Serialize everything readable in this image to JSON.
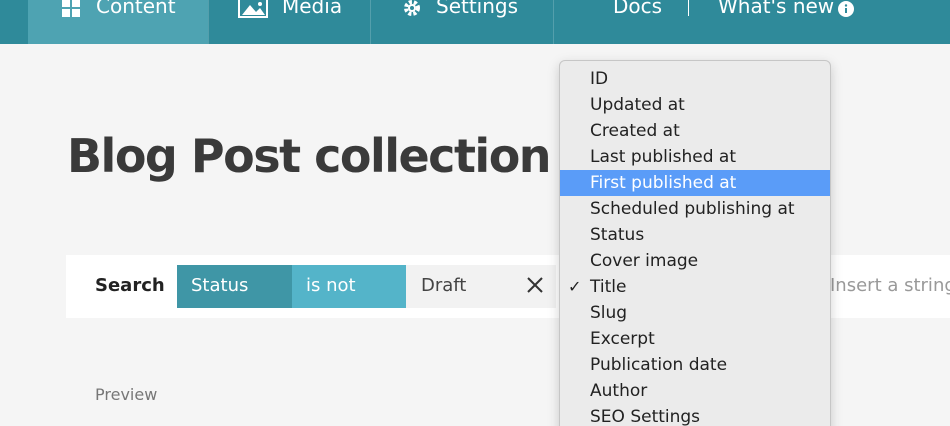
{
  "nav": {
    "items": [
      {
        "label": "Content",
        "icon": "content-icon"
      },
      {
        "label": "Media",
        "icon": "image-icon"
      },
      {
        "label": "Settings",
        "icon": "gear-icon"
      }
    ],
    "docs": "Docs",
    "whats_new": "What's new"
  },
  "page": {
    "title": "Blog Post collection"
  },
  "search": {
    "label": "Search",
    "field": "Status",
    "operator": "is not",
    "value": "Draft",
    "placeholder": "Insert a string..."
  },
  "preview": {
    "label": "Preview"
  },
  "dropdown": {
    "items": [
      {
        "label": "ID"
      },
      {
        "label": "Updated at"
      },
      {
        "label": "Created at"
      },
      {
        "label": "Last published at"
      },
      {
        "label": "First published at",
        "highlighted": true
      },
      {
        "label": "Scheduled publishing at"
      },
      {
        "label": "Status"
      },
      {
        "label": "Cover image"
      },
      {
        "label": "Title",
        "checked": true,
        "check_mark": "✓"
      },
      {
        "label": "Slug"
      },
      {
        "label": "Excerpt"
      },
      {
        "label": "Publication date"
      },
      {
        "label": "Author"
      },
      {
        "label": "SEO Settings"
      }
    ]
  },
  "colors": {
    "nav_bg": "#2f8a9a",
    "nav_active": "#4ea3b2",
    "chip_field": "#3f96a6",
    "chip_operator": "#54b4c9",
    "dropdown_highlight": "#5a9cf8"
  }
}
